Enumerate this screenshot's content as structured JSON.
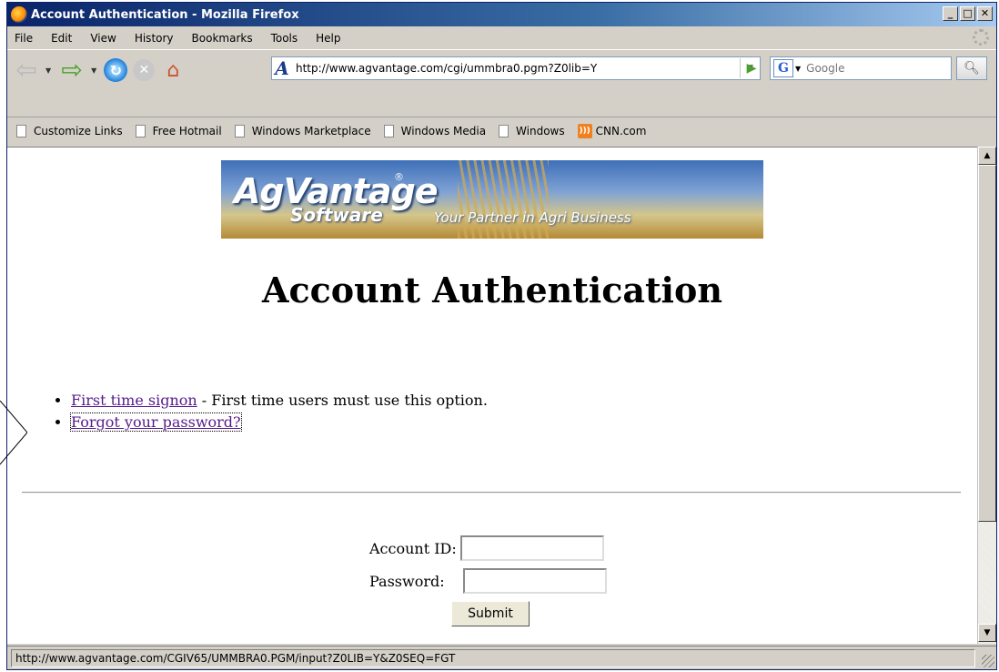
{
  "window": {
    "title": "Account Authentication - Mozilla Firefox",
    "controls": {
      "minimize": "_",
      "maximize": "□",
      "close": "✕"
    }
  },
  "menu": [
    "File",
    "Edit",
    "View",
    "History",
    "Bookmarks",
    "Tools",
    "Help"
  ],
  "toolbar": {
    "back_icon": "back-arrow-icon",
    "forward_icon": "forward-arrow-icon",
    "url": "http://www.agvantage.com/cgi/ummbra0.pgm?Z0lib=Y",
    "search_placeholder": "Google",
    "search_engine_glyph": "G"
  },
  "bookmarks": [
    {
      "label": "Customize Links",
      "icon": "page-icon"
    },
    {
      "label": "Free Hotmail",
      "icon": "page-icon"
    },
    {
      "label": "Windows Marketplace",
      "icon": "page-icon"
    },
    {
      "label": "Windows Media",
      "icon": "page-icon"
    },
    {
      "label": "Windows",
      "icon": "page-icon"
    },
    {
      "label": "CNN.com",
      "icon": "rss-icon"
    }
  ],
  "banner": {
    "brand": "AgVantage",
    "registered": "®",
    "software": "Software",
    "tagline": "Your Partner in Agri Business"
  },
  "page": {
    "heading": "Account Authentication",
    "options": [
      {
        "link": "First time signon",
        "description": " - First time users must use this option."
      },
      {
        "link": "Forgot your password?",
        "description": ""
      }
    ]
  },
  "form": {
    "account_label": "Account ID:",
    "account_value": "",
    "password_label": "Password:",
    "password_value": "",
    "submit_label": "Submit"
  },
  "status": {
    "text": "http://www.agvantage.com/CGIV65/UMMBRA0.PGM/input?Z0LIB=Y&Z0SEQ=FGT"
  }
}
